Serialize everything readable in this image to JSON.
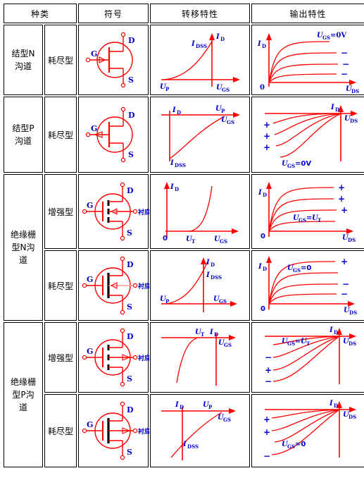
{
  "table": {
    "headers": [
      {
        "key": "kind",
        "label": "种类"
      },
      {
        "key": "symbol",
        "label": "符号"
      },
      {
        "key": "transfer",
        "label": "转移特性"
      },
      {
        "key": "output",
        "label": "输出特性"
      }
    ],
    "categories": [
      {
        "label": "结型N\n沟道",
        "rows": 1
      },
      {
        "label": "结型P\n沟道",
        "rows": 1
      },
      {
        "label": "绝缘栅\n型N沟\n道",
        "rows": 2
      },
      {
        "label": "绝缘栅\n型P沟\n道",
        "rows": 2
      }
    ],
    "rows": [
      {
        "id": "jfet-n-depletion",
        "category": "结型N沟道",
        "mode": "耗尽型",
        "symbol": {
          "type": "jfet",
          "channel": "N",
          "terminals": [
            "G",
            "D",
            "S"
          ],
          "arrow": "in"
        },
        "transfer": {
          "axis_y": "ID",
          "axis_x": "UGS",
          "labels": [
            "IDSS",
            "UP"
          ],
          "quadrant": "II-to-origin"
        },
        "output": {
          "axis_y": "ID",
          "axis_x": "UDS",
          "origin_label": "0",
          "curve_labels": [
            "UGS=0V",
            "−",
            "−",
            "−"
          ]
        }
      },
      {
        "id": "jfet-p-depletion",
        "category": "结型P沟道",
        "mode": "耗尽型",
        "symbol": {
          "type": "jfet",
          "channel": "P",
          "terminals": [
            "G",
            "D",
            "S"
          ],
          "arrow": "out"
        },
        "transfer": {
          "axis_y": "ID",
          "axis_x": "UGS",
          "labels": [
            "IDSS",
            "UP"
          ],
          "quadrant": "IV"
        },
        "output": {
          "axis_y": "ID",
          "axis_x": "UDS",
          "curve_labels": [
            "+",
            "+",
            "+",
            "UGS=0V"
          ]
        }
      },
      {
        "id": "mosfet-n-enhancement",
        "category": "绝缘栅型N沟道",
        "mode": "增强型",
        "symbol": {
          "type": "mosfet",
          "channel": "N",
          "mode": "enhancement",
          "terminals": [
            "G",
            "D",
            "S",
            "衬底"
          ],
          "arrow": "in"
        },
        "transfer": {
          "axis_y": "ID",
          "axis_x": "UGS",
          "labels": [
            "UT"
          ],
          "origin_label": "0"
        },
        "output": {
          "axis_y": "ID",
          "axis_x": "UDS",
          "origin_label": "0",
          "curve_labels": [
            "+",
            "+",
            "+",
            "UGS=UT"
          ]
        }
      },
      {
        "id": "mosfet-n-depletion",
        "category": "绝缘栅型N沟道",
        "mode": "耗尽型",
        "symbol": {
          "type": "mosfet",
          "channel": "N",
          "mode": "depletion",
          "terminals": [
            "G",
            "D",
            "S",
            "衬底"
          ],
          "arrow": "in"
        },
        "transfer": {
          "axis_y": "ID",
          "axis_x": "UGS",
          "labels": [
            "IDSS",
            "UP"
          ]
        },
        "output": {
          "axis_y": "ID",
          "axis_x": "UDS",
          "origin_label": "0",
          "curve_labels": [
            "+",
            "UGS=0",
            "−",
            "−"
          ]
        }
      },
      {
        "id": "mosfet-p-enhancement",
        "category": "绝缘栅型P沟道",
        "mode": "增强型",
        "symbol": {
          "type": "mosfet",
          "channel": "P",
          "mode": "enhancement",
          "terminals": [
            "G",
            "D",
            "S",
            "衬底"
          ],
          "arrow": "out"
        },
        "transfer": {
          "axis_y": "ID",
          "axis_x": "UGS",
          "labels": [
            "UT"
          ]
        },
        "output": {
          "axis_y": "ID",
          "axis_x": "UDS",
          "curve_labels": [
            "UGS=UT",
            "−",
            "+",
            "−"
          ]
        }
      },
      {
        "id": "mosfet-p-depletion",
        "category": "绝缘栅型P沟道",
        "mode": "耗尽型",
        "symbol": {
          "type": "mosfet",
          "channel": "P",
          "mode": "depletion",
          "terminals": [
            "G",
            "D",
            "S",
            "衬底"
          ],
          "arrow": "out"
        },
        "transfer": {
          "axis_y": "ID",
          "axis_x": "UGS",
          "labels": [
            "IDSS",
            "UP"
          ]
        },
        "output": {
          "axis_y": "ID",
          "axis_x": "UDS",
          "curve_labels": [
            "+",
            "+",
            "UGS=0",
            "−"
          ]
        }
      }
    ]
  },
  "glyphs": {
    "ID": "I",
    "IDSS": "I",
    "UGS": "U",
    "UDS": "U",
    "UP": "U",
    "UT": "U",
    "sub_D": "D",
    "sub_DSS": "DSS",
    "sub_GS": "GS",
    "sub_DS": "DS",
    "sub_P": "P",
    "sub_T": "T",
    "zero": "0",
    "plus": "+",
    "minus": "−",
    "ugs_0v": "U",
    "ugs_eq_ut": "U",
    "ugs_eq_0": "U",
    "label_ugs_0v_text": "=0V",
    "label_ugs_eq_ut_text": "=",
    "label_ugs_eq_0_text": "=0"
  },
  "colors": {
    "header_bg": "#ffff00",
    "border": "#000000",
    "curve": "#ff0000",
    "label": "#0000cc",
    "text": "#000000",
    "background": "#ffffff"
  },
  "terminals": {
    "G": "G",
    "D": "D",
    "S": "S",
    "substrate": "衬底"
  }
}
